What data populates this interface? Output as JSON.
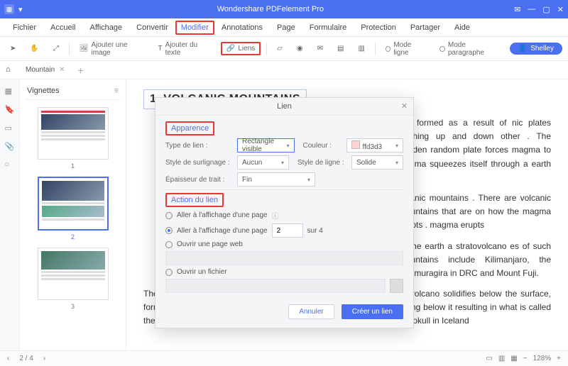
{
  "titlebar": {
    "app_title": "Wondershare PDFelement Pro"
  },
  "menubar": {
    "items": [
      "Fichier",
      "Accueil",
      "Affichage",
      "Convertir",
      "Modifier",
      "Annotations",
      "Page",
      "Formulaire",
      "Protection",
      "Partager",
      "Aide"
    ],
    "active_index": 4
  },
  "toolbar": {
    "add_image": "Ajouter une image",
    "add_text": "Ajouter du texte",
    "links": "Liens",
    "mode_line": "Mode ligne",
    "mode_para": "Mode paragraphe",
    "user": "Shelley"
  },
  "tabs": {
    "doc_name": "Mountain"
  },
  "thumbnails": {
    "header": "Vignettes",
    "labels": [
      "1",
      "2",
      "3"
    ],
    "selected": 2
  },
  "document": {
    "heading": "1. VOLCANIC MOUNTAINS",
    "p1_right": " are formed as a result of nic plates pushing up and down other . The sudden  random plate forces magma  to the ma squeezes itself through a earth´s",
    "p2_right": "olcanic mountains . There are volcanic mountains that are on how the magma erupts . magma erupts",
    "p3_right": " of the earth a stratovolcano es of such mountains include Kilimanjaro, the Nyamuragira in DRC and Mount Fuji.",
    "p4": "The other type of volcanic mountain is formed when the magma or volcano solidifies below the surface, forming a dome mountain. The magma is pushed up by the forces acting below it resulting in what is called the dome mountain. Mountains formed by such a process include Torfajokull in Iceland"
  },
  "dialog": {
    "title": "Lien",
    "section_appearance": "Apparence",
    "labels": {
      "link_type": "Type de lien :",
      "highlight": "Style de surlignage :",
      "thickness": "Épaisseur de trait :",
      "color": "Couleur :",
      "line_style": "Style de ligne :"
    },
    "values": {
      "link_type": "Rectangle visible",
      "highlight": "Aucun",
      "thickness": "Fin",
      "color": "ffd3d3",
      "line_style": "Solide"
    },
    "section_action": "Action du lien",
    "actions": {
      "goto_view": "Aller à l'affichage d'une page",
      "goto_page": "Aller à l'affichage d'une page",
      "page_value": "2",
      "page_of": "sur 4",
      "open_web": "Ouvrir une page web",
      "open_file": "Ouvrir un fichier"
    },
    "buttons": {
      "cancel": "Annuler",
      "create": "Créer un lien"
    }
  },
  "statusbar": {
    "page": "2 / 4",
    "zoom": "128%"
  }
}
